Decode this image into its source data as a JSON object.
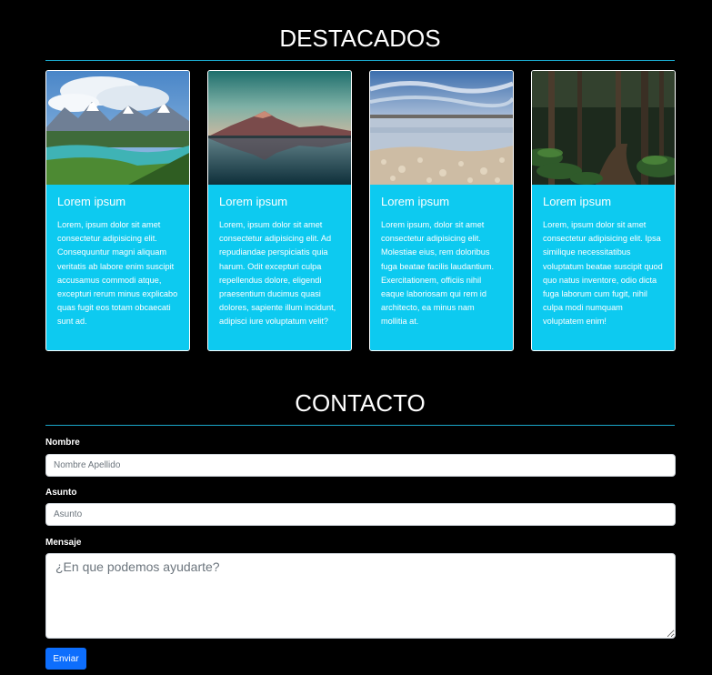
{
  "featured": {
    "title": "DESTACADOS",
    "cards": [
      {
        "image": "mountain-lake-photo",
        "title": "Lorem ipsum",
        "text": "Lorem, ipsum dolor sit amet consectetur adipisicing elit. Consequuntur magni aliquam veritatis ab labore enim suscipit accusamus commodi atque, excepturi rerum minus explicabo quas fugit eos totam obcaecati sunt ad."
      },
      {
        "image": "mountain-reflection-photo",
        "title": "Lorem ipsum",
        "text": "Lorem, ipsum dolor sit amet consectetur adipisicing elit. Ad repudiandae perspiciatis quia harum. Odit excepturi culpa repellendus dolore, eligendi praesentium ducimus quasi dolores, sapiente illum incidunt, adipisci iure voluptatum velit?"
      },
      {
        "image": "salt-flat-photo",
        "title": "Lorem ipsum",
        "text": "Lorem ipsum, dolor sit amet consectetur adipisicing elit. Molestiae eius, rem doloribus fuga beatae facilis laudantium. Exercitationem, officiis nihil eaque laboriosam qui rem id architecto, ea minus nam mollitia at."
      },
      {
        "image": "forest-path-photo",
        "title": "Lorem ipsum",
        "text": "Lorem, ipsum dolor sit amet consectetur adipisicing elit. Ipsa similique necessitatibus voluptatum beatae suscipit quod quo natus inventore, odio dicta fuga laborum cum fugit, nihil culpa modi numquam voluptatem enim!"
      }
    ]
  },
  "contact": {
    "title": "CONTACTO",
    "name_label": "Nombre",
    "name_placeholder": "Nombre Apellido",
    "name_value": "",
    "subject_label": "Asunto",
    "subject_placeholder": "Asunto",
    "subject_value": "",
    "message_label": "Mensaje",
    "message_placeholder": "¿En que podemos ayudarte?",
    "message_value": "",
    "submit_label": "Enviar"
  },
  "colors": {
    "background": "#000000",
    "card": "#0dcaf0",
    "rule": "#1aa6c9",
    "button": "#0d6efd"
  }
}
